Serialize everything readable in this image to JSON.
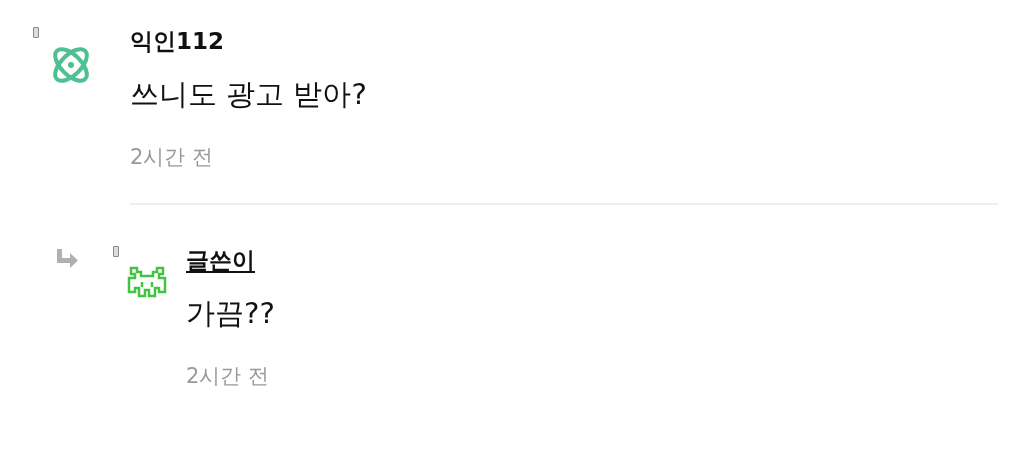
{
  "comments": [
    {
      "author": "익인112",
      "is_writer": false,
      "kind": "atom",
      "text": "쓰니도 광고 받아?",
      "time": "2시간 전",
      "children": [
        {
          "author": "글쓴이",
          "is_writer": true,
          "kind": "invader",
          "text": "가끔??",
          "time": "2시간 전"
        }
      ]
    }
  ]
}
